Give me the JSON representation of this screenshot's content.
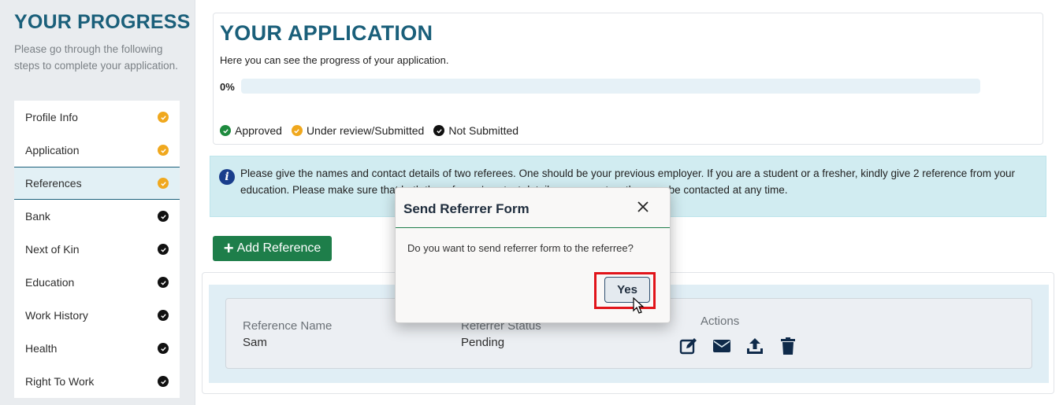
{
  "sidebar": {
    "title": "YOUR PROGRESS",
    "description": "Please go through the following steps to complete your application.",
    "items": [
      {
        "label": "Profile Info",
        "status": "orange"
      },
      {
        "label": "Application",
        "status": "orange"
      },
      {
        "label": "References",
        "status": "orange"
      },
      {
        "label": "Bank",
        "status": "black"
      },
      {
        "label": "Next of Kin",
        "status": "black"
      },
      {
        "label": "Education",
        "status": "black"
      },
      {
        "label": "Work History",
        "status": "black"
      },
      {
        "label": "Health",
        "status": "black"
      },
      {
        "label": "Right To Work",
        "status": "black"
      }
    ]
  },
  "application": {
    "title": "YOUR APPLICATION",
    "subtitle": "Here you can see the progress of your application.",
    "progress_label": "0%",
    "progress_value": 0,
    "legend": {
      "approved": "Approved",
      "under_review": "Under review/Submitted",
      "not_submitted": "Not Submitted"
    }
  },
  "info": {
    "text": "Please give the names and contact details of two referees. One should be your previous employer. If you are a student or a fresher, kindly give 2 reference from your education. Please make sure that both the referees' contact details are correct so they can be contacted at any time."
  },
  "actions": {
    "add_reference": "Add Reference"
  },
  "reference": {
    "name_label": "Reference Name",
    "name_value": "Sam",
    "status_label": "Referrer Status",
    "status_value": "Pending",
    "actions_label": "Actions",
    "action_icons": [
      "edit-icon",
      "envelope-icon",
      "upload-icon",
      "trash-icon"
    ]
  },
  "modal": {
    "title": "Send Referrer Form",
    "message": "Do you want to send referrer form to the referree?",
    "yes_label": "Yes"
  },
  "colors": {
    "brand": "#1a5f7a",
    "approved": "#1e8a3e",
    "under_review": "#f0a81e",
    "not_submitted": "#111111",
    "add_button": "#1e7e4a",
    "highlight": "#e1141a"
  }
}
